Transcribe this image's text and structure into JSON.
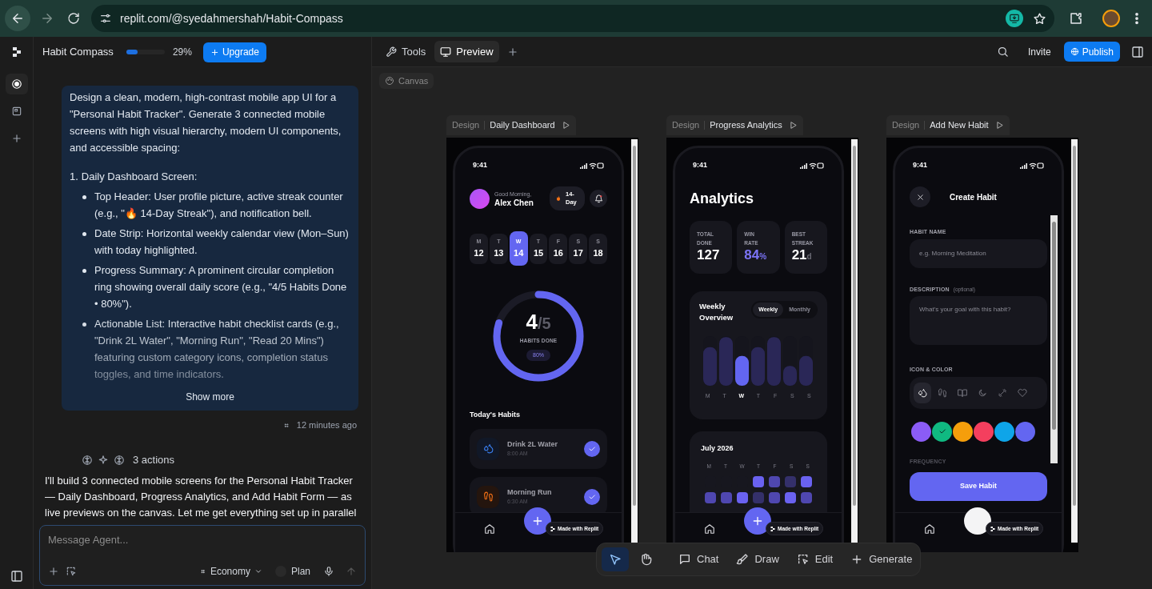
{
  "browser": {
    "url": "replit.com/@syedahmershah/Habit-Compass"
  },
  "rail": {
    "items": [
      {
        "kind": "agent",
        "selected": true
      },
      {
        "kind": "pages",
        "selected": false
      },
      {
        "kind": "add",
        "selected": false
      }
    ]
  },
  "chat": {
    "project": "Habit Compass",
    "usage": {
      "level": 0.29,
      "reading": "29%"
    },
    "upgrade": "Upgrade",
    "prompt": {
      "intro": "Design a clean, modern, high-contrast mobile app UI for a \"Personal Habit Tracker\". Generate 3 connected mobile screens with high visual hierarchy, modern UI components, and accessible spacing:",
      "sections": [
        {
          "number": "1.",
          "title": "Daily Dashboard Screen:",
          "bullets": [
            "Top Header: User profile picture, active streak counter (e.g., \"🔥 14-Day Streak\"), and notification bell.",
            "Date Strip: Horizontal weekly calendar view (Mon–Sun) with today highlighted.",
            "Progress Summary: A prominent circular completion ring showing overall daily score (e.g., \"4/5 Habits Done • 80%\").",
            "Actionable List: Interactive habit checklist cards (e.g., \"Drink 2L Water\", \"Morning Run\", \"Read 20 Mins\") featuring custom category icons, completion status toggles, and time indicators."
          ]
        }
      ],
      "show_more": "Show more"
    },
    "time": "12 minutes ago",
    "actions": "3 actions",
    "reply": "I'll build 3 connected mobile screens for the Personal Habit Tracker — Daily Dashboard, Progress Analytics, and Add Habit Form — as live previews on the canvas. Let me get everything set up in parallel",
    "input": {
      "placeholder": "Message Agent...",
      "mode": "Economy",
      "plan": {
        "label": "Plan",
        "on": false
      }
    }
  },
  "canvas": {
    "tabs": [
      {
        "kind": "tools",
        "label": "Tools",
        "selected": false
      },
      {
        "kind": "preview",
        "label": "Preview",
        "selected": true
      }
    ],
    "invite": "Invite",
    "publish": "Publish",
    "chip": "Canvas"
  },
  "frames": [
    {
      "prefix": "Design",
      "title": "Daily Dashboard",
      "screen": {
        "kind": "dashboard",
        "time": "9:41",
        "greeting": "Good Morning,",
        "name": "Alex Chen",
        "streak": "14-Day",
        "days": [
          {
            "letter": "M",
            "date": "12",
            "selected": false
          },
          {
            "letter": "T",
            "date": "13",
            "selected": false
          },
          {
            "letter": "W",
            "date": "14",
            "selected": true
          },
          {
            "letter": "T",
            "date": "15",
            "selected": false
          },
          {
            "letter": "F",
            "date": "16",
            "selected": false
          },
          {
            "letter": "S",
            "date": "17",
            "selected": false
          },
          {
            "letter": "S",
            "date": "18",
            "selected": false
          }
        ],
        "ring": {
          "done": "4",
          "total": "/5",
          "caption": "HABITS DONE",
          "percent": "80%",
          "level": 0.8
        },
        "list_title": "Today's Habits",
        "habits": [
          {
            "kind": "water",
            "name": "Drink 2L Water",
            "time": "8:00 AM",
            "checked": true
          },
          {
            "kind": "run",
            "name": "Morning Run",
            "time": "6:30 AM",
            "checked": true
          }
        ],
        "badge": "Made with Replit"
      }
    },
    {
      "prefix": "Design",
      "title": "Progress Analytics",
      "screen": {
        "kind": "analytics",
        "time": "9:41",
        "heading": "Analytics",
        "stats": [
          {
            "label": "TOTAL DONE",
            "value": "127",
            "highlighted": false
          },
          {
            "label": "WIN RATE",
            "value": "84",
            "unit": "%",
            "highlighted": true
          },
          {
            "label": "BEST STREAK",
            "value": "21",
            "unit": "d",
            "highlighted": false
          }
        ],
        "weekly": {
          "title": "Weekly Overview",
          "toggle": [
            {
              "label": "Weekly",
              "selected": true
            },
            {
              "label": "Monthly",
              "selected": false
            }
          ],
          "days": [
            {
              "label": "M",
              "selected": false
            },
            {
              "label": "T",
              "selected": false
            },
            {
              "label": "W",
              "selected": true
            },
            {
              "label": "T",
              "selected": false
            },
            {
              "label": "F",
              "selected": false
            },
            {
              "label": "S",
              "selected": false
            },
            {
              "label": "S",
              "selected": false
            }
          ]
        },
        "calendar": {
          "title": "July 2026",
          "days": [
            "M",
            "T",
            "W",
            "T",
            "F",
            "S",
            "S"
          ]
        },
        "badge": "Made with Replit"
      }
    },
    {
      "prefix": "Design",
      "title": "Add New Habit",
      "screen": {
        "kind": "form",
        "time": "9:41",
        "heading": "Create Habit",
        "fields": [
          {
            "kind": "input",
            "label": "HABIT NAME",
            "placeholder": "e.g. Morning Meditation"
          },
          {
            "kind": "textarea",
            "label": "DESCRIPTION",
            "note": "(optional)",
            "placeholder": "What's your goal with this habit?"
          }
        ],
        "icon_color_label": "ICON & COLOR",
        "icons": [
          {
            "kind": "drops",
            "selected": true
          },
          {
            "kind": "footprints",
            "selected": false
          },
          {
            "kind": "book",
            "selected": false
          },
          {
            "kind": "moon",
            "selected": false
          },
          {
            "kind": "dumbbell",
            "selected": false
          },
          {
            "kind": "heart",
            "selected": false
          }
        ],
        "colors": [
          {
            "color": "#8b5cf6",
            "selected": false
          },
          {
            "color": "#10b981",
            "selected": true
          },
          {
            "color": "#f59e0b",
            "selected": false
          },
          {
            "color": "#f43f5e",
            "selected": false
          },
          {
            "color": "#0ea5e9",
            "selected": false
          },
          {
            "color": "#6366f1",
            "selected": false
          }
        ],
        "frequency_label": "FREQUENCY",
        "save": "Save Habit",
        "badge": "Made with Replit"
      }
    }
  ],
  "toolbar": {
    "tools": [
      {
        "kind": "select",
        "selected": true
      },
      {
        "kind": "hand",
        "selected": false
      }
    ],
    "actions": [
      {
        "kind": "chat",
        "label": "Chat"
      },
      {
        "kind": "draw",
        "label": "Draw"
      },
      {
        "kind": "edit",
        "label": "Edit"
      },
      {
        "kind": "generate",
        "label": "Generate"
      }
    ]
  }
}
